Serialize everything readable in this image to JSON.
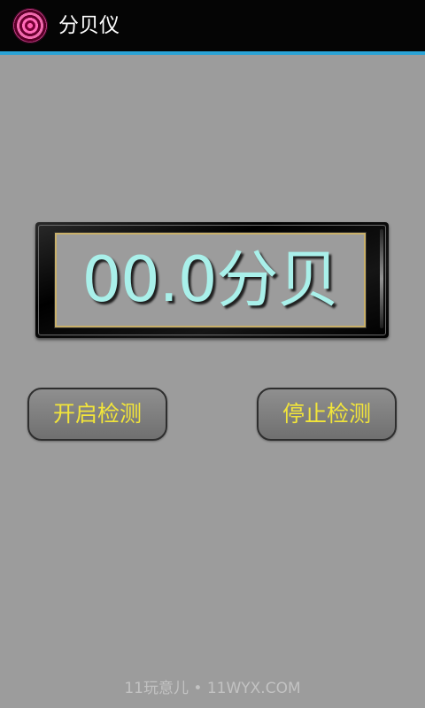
{
  "app": {
    "title": "分贝仪",
    "icon": "concentric-circles-app-icon"
  },
  "meter": {
    "reading": "00.0分贝"
  },
  "buttons": {
    "start_label": "开启检测",
    "stop_label": "停止检测"
  },
  "watermark": {
    "text": "11玩意儿 • 11WYX.COM"
  },
  "colors": {
    "background": "#9c9c9c",
    "titlebar": "#050505",
    "accent": "#2aa3d6",
    "reading_text": "#a9f0ea",
    "button_text": "#f2e53a"
  }
}
